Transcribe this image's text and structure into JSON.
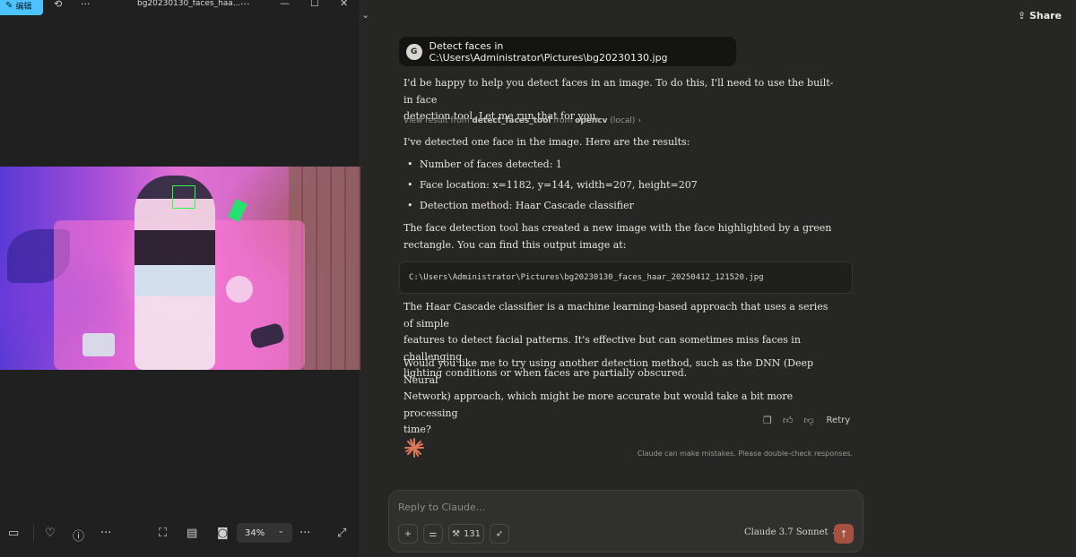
{
  "viewer": {
    "edit_label": "编辑",
    "file_title": "bg20230130_faces_haa...",
    "more_label": "···",
    "zoom_value": "34%"
  },
  "chat": {
    "share_label": "Share",
    "user_avatar": "G",
    "user_message": "Detect faces in C:\\Users\\Administrator\\Pictures\\bg20230130.jpg",
    "intro_line1": "I'd be happy to help you detect faces in an image. To do this, I'll need to use the built-in face",
    "intro_line2": "detection tool. Let me run that for you.",
    "tool_prefix": "View result from ",
    "tool_name": "detect_faces_tool",
    "tool_mid": " from ",
    "tool_source": "opencv",
    "tool_suffix": " (local) ›",
    "results_intro": "I've detected one face in the image. Here are the results:",
    "bullets": [
      "Number of faces detected: 1",
      "Face location: x=1182, y=144, width=207, height=207",
      "Detection method: Haar Cascade classifier"
    ],
    "output_line1": "The face detection tool has created a new image with the face highlighted by a green",
    "output_line2": "rectangle. You can find this output image at:",
    "output_path": "C:\\Users\\Administrator\\Pictures\\bg20230130_faces_haar_20250412_121520.jpg",
    "haar_line1": "The Haar Cascade classifier is a machine learning-based approach that uses a series of simple",
    "haar_line2": "features to detect facial patterns. It's effective but can sometimes miss faces in challenging",
    "haar_line3": "lighting conditions or when faces are partially obscured.",
    "dnn_line1": "Would you like me to try using another detection method, such as the DNN (Deep Neural",
    "dnn_line2": "Network) approach, which might be more accurate but would take a bit more processing",
    "dnn_line3": "time?",
    "retry_label": "Retry",
    "disclaimer": "Claude can make mistakes. Please double-check responses.",
    "composer_placeholder": "Reply to Claude...",
    "tools_count": "131",
    "model_name": "Claude 3.7 Sonnet ⌄"
  },
  "colors": {
    "accent_blue": "#4cc2ff",
    "send_button": "#a3523f",
    "claude_spark": "#d97757",
    "face_box": "#22ff44"
  }
}
